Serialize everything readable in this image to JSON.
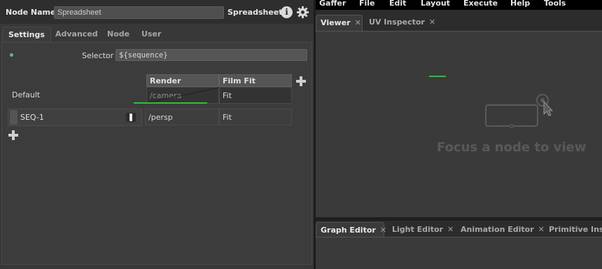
{
  "node_editor": {
    "name_label": "Node Name",
    "name_value": "Spreadsheet",
    "type_label": "Spreadsheet",
    "tabs": [
      "Settings",
      "Advanced",
      "Node",
      "User"
    ]
  },
  "settings": {
    "selector_label": "Selector",
    "selector_value": "${sequence}",
    "columns": [
      "Render Camera",
      "Film Fit"
    ],
    "default_row": {
      "label": "Default",
      "render_camera": "/camera",
      "film_fit": "Fit"
    },
    "rows": [
      {
        "label": "SEQ-1",
        "render_camera": "/persp",
        "film_fit": "Fit"
      }
    ]
  },
  "menubar": {
    "items": [
      "Gaffer",
      "File",
      "Edit",
      "Layout",
      "Execute",
      "Help",
      "Tools"
    ]
  },
  "viewer_panel": {
    "tabs": [
      "Viewer",
      "UV Inspector"
    ],
    "message": "Focus a node to view"
  },
  "bottom_panel": {
    "tabs": [
      "Graph Editor",
      "Light Editor",
      "Animation Editor",
      "Primitive Insp"
    ]
  },
  "colors": {
    "accent_green": "#2bbf3b",
    "panel_bg": "#383838",
    "menubar_bg": "#000000"
  }
}
